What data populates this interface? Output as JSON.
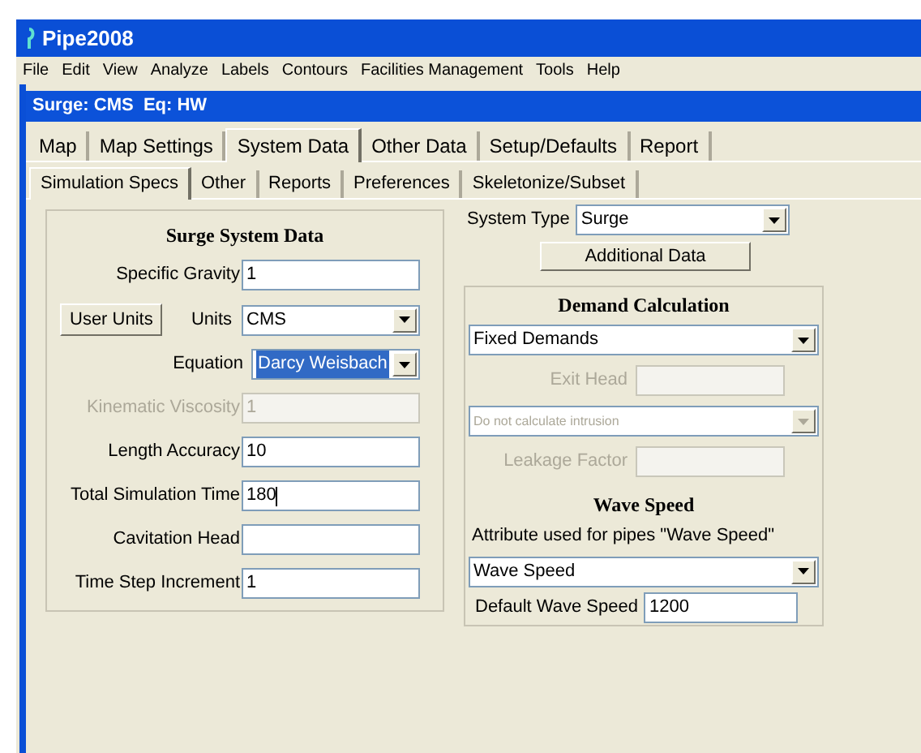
{
  "window": {
    "title": "Pipe2008"
  },
  "menu": [
    "File",
    "Edit",
    "View",
    "Analyze",
    "Labels",
    "Contours",
    "Facilities Management",
    "Tools",
    "Help"
  ],
  "document": {
    "title": "Surge: CMS  Eq: HW"
  },
  "tabs": [
    {
      "label": "Map",
      "selected": false
    },
    {
      "label": "Map Settings",
      "selected": false
    },
    {
      "label": "System Data",
      "selected": true
    },
    {
      "label": "Other Data",
      "selected": false
    },
    {
      "label": "Setup/Defaults",
      "selected": false
    },
    {
      "label": "Report",
      "selected": false
    }
  ],
  "subtabs": [
    {
      "label": "Simulation Specs",
      "selected": true
    },
    {
      "label": "Other",
      "selected": false
    },
    {
      "label": "Reports",
      "selected": false
    },
    {
      "label": "Preferences",
      "selected": false
    },
    {
      "label": "Skeletonize/Subset",
      "selected": false
    }
  ],
  "surge_system_data": {
    "title": "Surge System Data",
    "fields": [
      {
        "kind": "text",
        "label": "Specific Gravity",
        "value": "1",
        "disabled": false,
        "focused": false
      },
      {
        "kind": "units",
        "button": "User Units",
        "label": "Units",
        "value": "CMS"
      },
      {
        "kind": "select",
        "label": "Equation",
        "value": "Darcy Weisbach",
        "highlighted": true
      },
      {
        "kind": "text",
        "label": "Kinematic Viscosity",
        "value": "1",
        "disabled": true,
        "focused": false
      },
      {
        "kind": "text",
        "label": "Length Accuracy",
        "value": "10",
        "disabled": false,
        "focused": false
      },
      {
        "kind": "text",
        "label": "Total Simulation Time",
        "value": "180",
        "disabled": false,
        "focused": true
      },
      {
        "kind": "text",
        "label": "Cavitation Head",
        "disabled": false,
        "focused": false
      },
      {
        "kind": "text",
        "label": "Time Step Increment",
        "value": "1",
        "disabled": false,
        "focused": false
      }
    ]
  },
  "system_type": {
    "label": "System Type",
    "value": "Surge"
  },
  "additional_data_button": "Additional Data",
  "demand_calculation": {
    "title": "Demand Calculation",
    "method": "Fixed Demands",
    "exit_head": {
      "label": "Exit Head",
      "disabled": true
    },
    "intrusion": {
      "value": "Do not calculate intrusion",
      "disabled": true
    },
    "leakage_factor": {
      "label": "Leakage Factor",
      "disabled": true
    }
  },
  "wave_speed": {
    "title": "Wave Speed",
    "attribute_label": "Attribute used for pipes \"Wave Speed\"",
    "attribute_value": "Wave Speed",
    "default_label": "Default Wave Speed",
    "default_value": "1200"
  }
}
